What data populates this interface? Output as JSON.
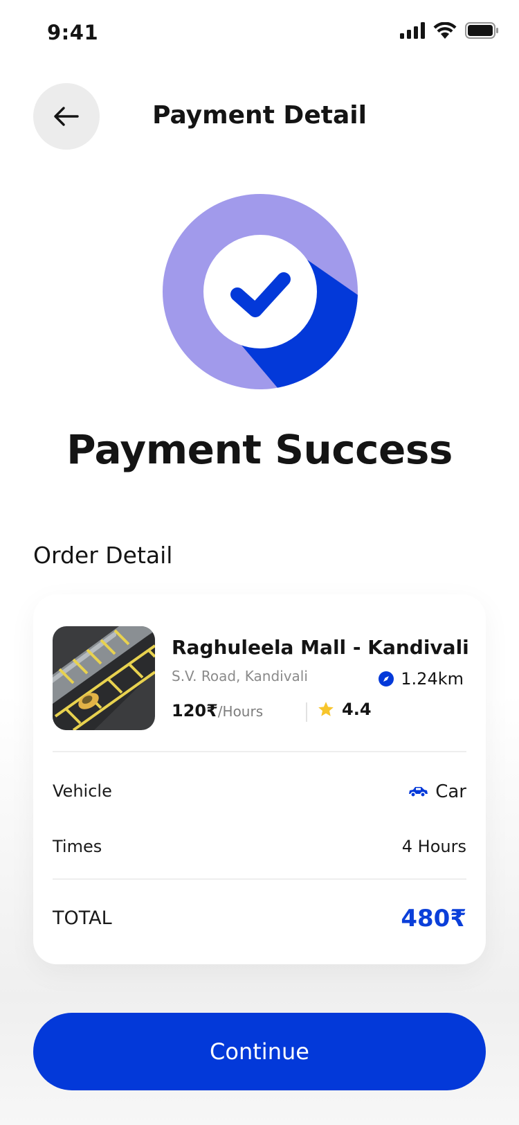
{
  "status_bar": {
    "time": "9:41"
  },
  "header": {
    "title": "Payment Detail"
  },
  "success": {
    "title": "Payment Success"
  },
  "order": {
    "section_title": "Order Detail",
    "place_name": "Raghuleela Mall - Kandivali",
    "address": "S.V. Road, Kandivali",
    "distance": "1.24km",
    "price": "120₹",
    "price_unit": "/Hours",
    "rating": "4.4",
    "vehicle_label": "Vehicle",
    "vehicle_value": "Car",
    "times_label": "Times",
    "times_value": "4 Hours",
    "total_label": "TOTAL",
    "total_value": "480₹"
  },
  "actions": {
    "continue_label": "Continue"
  },
  "colors": {
    "accent": "#0339d9",
    "ring": "#a19aeb",
    "star": "#f7c52b",
    "back_bg": "#ececec"
  }
}
